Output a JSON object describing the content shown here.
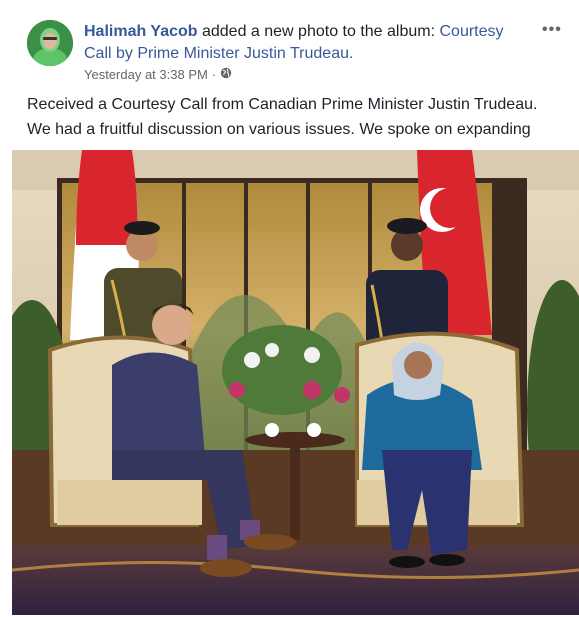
{
  "post": {
    "author": "Halimah Yacob",
    "action": " added a new photo to the album: ",
    "album": "Courtesy Call by Prime Minister Justin Trudeau.",
    "timestamp": "Yesterday at 3:38 PM",
    "separator": "·",
    "privacy_icon": "globe-icon",
    "more_icon": "more-options-icon",
    "more_label": "•••",
    "caption_line1": "Received a Courtesy Call from Canadian Prime Minister Justin Trudeau.",
    "caption_line2": "We had a fruitful discussion on various issues. We spoke on expanding"
  },
  "colors": {
    "link": "#385898",
    "text": "#1d2129",
    "meta": "#616770"
  }
}
